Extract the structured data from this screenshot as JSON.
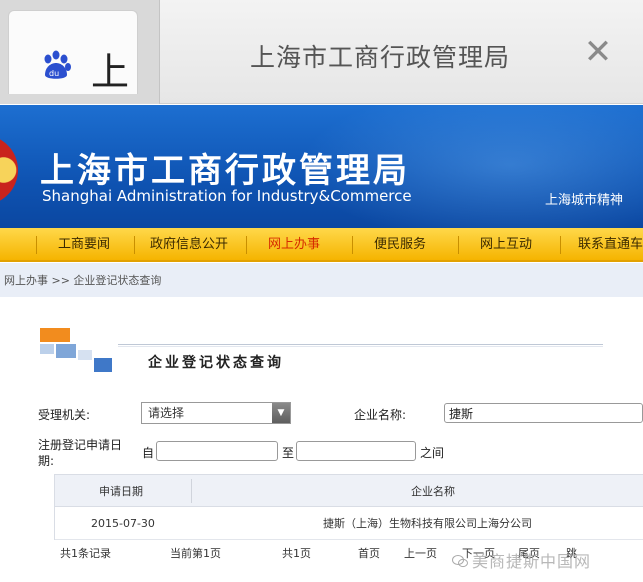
{
  "browser": {
    "tab_partial_text": "上",
    "heading": "上海市工商行政管理局",
    "close_glyph": "✕"
  },
  "banner": {
    "title": "上海市工商行政管理局",
    "subtitle": "Shanghai Administration for Industry&Commerce",
    "slogan": "上海城市精神"
  },
  "nav": {
    "items": [
      {
        "label": "工商要闻"
      },
      {
        "label": "政府信息公开"
      },
      {
        "label": "网上办事"
      },
      {
        "label": "便民服务"
      },
      {
        "label": "网上互动"
      },
      {
        "label": "联系直通车"
      }
    ],
    "active_index": 2
  },
  "breadcrumb": "网上办事 >> 企业登记状态查询",
  "section": {
    "title": "企业登记状态查询"
  },
  "form": {
    "agency_label": "受理机关:",
    "agency_value": "请选择",
    "company_label": "企业名称:",
    "company_value": "捷斯",
    "date_label_line1": "注册登记申请日",
    "date_label_line2": "期:",
    "from_label": "自",
    "to_label": "至",
    "between_label": "之间",
    "from_value": "",
    "to_value": ""
  },
  "table": {
    "columns": [
      "申请日期",
      "企业名称"
    ],
    "rows": [
      {
        "date": "2015-07-30",
        "name": "捷斯（上海）生物科技有限公司上海分公司"
      }
    ]
  },
  "pagination": {
    "total": "共1条记录",
    "current": "当前第1页",
    "pages": "共1页",
    "first": "首页",
    "prev": "上一页",
    "next": "下一页",
    "last": "尾页",
    "go": "跳"
  },
  "watermark": "美商捷斯中国网",
  "colors": {
    "banner_blue": "#0f54b3",
    "nav_yellow": "#f5b400",
    "active_nav": "#d62b00"
  }
}
